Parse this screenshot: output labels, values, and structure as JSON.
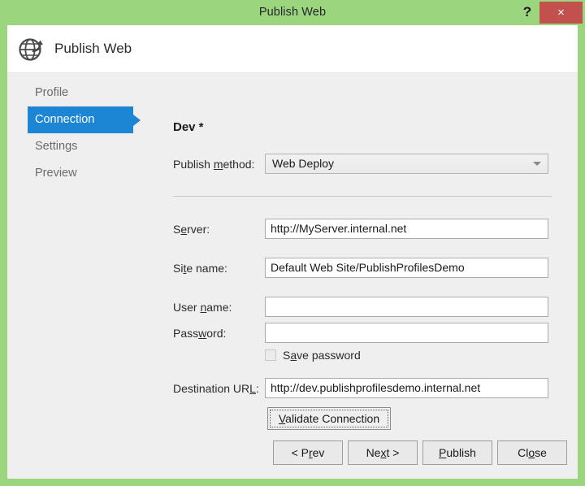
{
  "window": {
    "title": "Publish Web",
    "help_label": "?",
    "close_label": "×",
    "chrome_color": "#9bd67f",
    "close_color": "#c2504d"
  },
  "header": {
    "icon": "globe-publish-icon",
    "title": "Publish Web"
  },
  "sidebar": {
    "items": [
      {
        "label": "Profile",
        "selected": false
      },
      {
        "label": "Connection",
        "selected": true
      },
      {
        "label": "Settings",
        "selected": false
      },
      {
        "label": "Preview",
        "selected": false
      }
    ],
    "selected_color": "#1c86d4"
  },
  "main": {
    "profile_heading": "Dev *",
    "publish_method": {
      "label_pre": "Publish ",
      "label_mnemonic": "m",
      "label_post": "ethod:",
      "value": "Web Deploy",
      "options": [
        "Web Deploy"
      ]
    },
    "fields": {
      "server": {
        "label_pre": "S",
        "label_mnemonic": "e",
        "label_post": "rver:",
        "value": "http://MyServer.internal.net",
        "placeholder": ""
      },
      "site_name": {
        "label_pre": "Si",
        "label_mnemonic": "t",
        "label_post": "e name:",
        "value": "Default Web Site/PublishProfilesDemo",
        "placeholder": ""
      },
      "user_name": {
        "label_pre": "User ",
        "label_mnemonic": "n",
        "label_post": "ame:",
        "value": "",
        "placeholder": ""
      },
      "password": {
        "label_pre": "Pass",
        "label_mnemonic": "w",
        "label_post": "ord:",
        "value": "",
        "placeholder": ""
      },
      "destination_url": {
        "label_pre": "Destination UR",
        "label_mnemonic": "L",
        "label_post": ":",
        "value": "http://dev.publishprofilesdemo.internal.net",
        "placeholder": ""
      }
    },
    "save_password": {
      "label_pre": "S",
      "label_mnemonic": "a",
      "label_post": "ve password",
      "checked": false
    },
    "validate_button": {
      "label_pre": "",
      "label_mnemonic": "V",
      "label_post": "alidate Connection"
    }
  },
  "footer": {
    "buttons": [
      {
        "label_pre": "< P",
        "label_mnemonic": "r",
        "label_post": "ev"
      },
      {
        "label_pre": "Ne",
        "label_mnemonic": "x",
        "label_post": "t >"
      },
      {
        "label_pre": "",
        "label_mnemonic": "P",
        "label_post": "ublish"
      },
      {
        "label_pre": "Cl",
        "label_mnemonic": "o",
        "label_post": "se"
      }
    ]
  }
}
